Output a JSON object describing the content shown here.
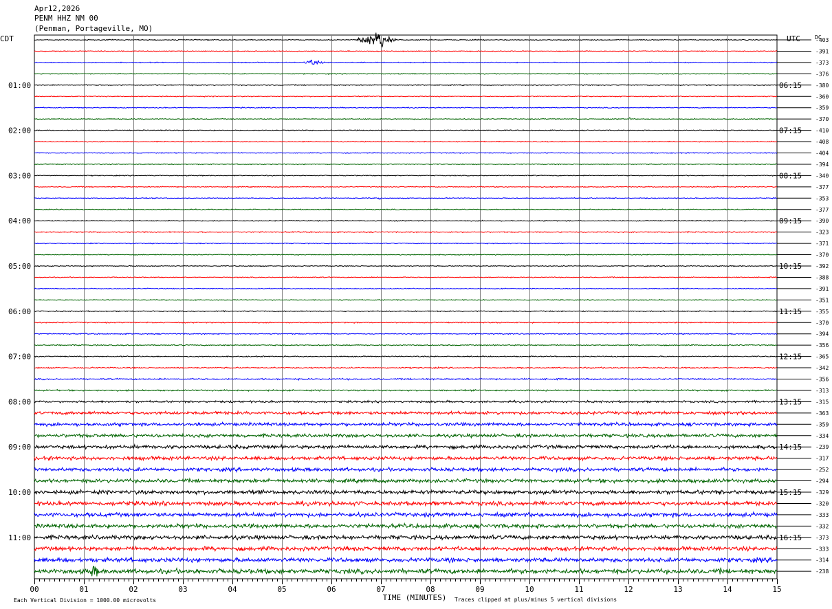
{
  "header": {
    "date": "Apr12,2026",
    "station": "PENM HHZ NM 00",
    "location": "(Penman, Portageville, MO)"
  },
  "zones": {
    "left": "CDT",
    "right": "UTC",
    "dc_header": "DC"
  },
  "chart_data": {
    "type": "line",
    "title": "",
    "xlabel": "TIME (MINUTES)",
    "ylabel": "",
    "xlim": [
      0,
      15
    ],
    "x_ticks": [
      "00",
      "01",
      "02",
      "03",
      "04",
      "05",
      "06",
      "07",
      "08",
      "09",
      "10",
      "11",
      "12",
      "13",
      "14",
      "15"
    ],
    "minutes_per_line": 15,
    "num_traces": 48,
    "colors": [
      "#000000",
      "#ff0000",
      "#0000ff",
      "#006400"
    ],
    "grid": true,
    "left_hour_labels": [
      {
        "trace": 4,
        "label": "01:00"
      },
      {
        "trace": 8,
        "label": "02:00"
      },
      {
        "trace": 12,
        "label": "03:00"
      },
      {
        "trace": 16,
        "label": "04:00"
      },
      {
        "trace": 20,
        "label": "05:00"
      },
      {
        "trace": 24,
        "label": "06:00"
      },
      {
        "trace": 28,
        "label": "07:00"
      },
      {
        "trace": 32,
        "label": "08:00"
      },
      {
        "trace": 36,
        "label": "09:00"
      },
      {
        "trace": 40,
        "label": "10:00"
      },
      {
        "trace": 44,
        "label": "11:00"
      }
    ],
    "right_hour_labels": [
      {
        "trace": 4,
        "label": "06:15"
      },
      {
        "trace": 8,
        "label": "07:15"
      },
      {
        "trace": 12,
        "label": "08:15"
      },
      {
        "trace": 16,
        "label": "09:15"
      },
      {
        "trace": 20,
        "label": "10:15"
      },
      {
        "trace": 24,
        "label": "11:15"
      },
      {
        "trace": 28,
        "label": "12:15"
      },
      {
        "trace": 32,
        "label": "13:15"
      },
      {
        "trace": 36,
        "label": "14:15"
      },
      {
        "trace": 40,
        "label": "15:15"
      },
      {
        "trace": 44,
        "label": "16:15"
      }
    ],
    "dc_values": [
      "-403",
      "-391",
      "-373",
      "-376",
      "-380",
      "-360",
      "-359",
      "-370",
      "-410",
      "-408",
      "-404",
      "-394",
      "-340",
      "-377",
      "-353",
      "-377",
      "-390",
      "-323",
      "-371",
      "-370",
      "-392",
      "-388",
      "-391",
      "-351",
      "-355",
      "-370",
      "-394",
      "-356",
      "-365",
      "-342",
      "-356",
      "-313",
      "-315",
      "-363",
      "-359",
      "-334",
      "-239",
      "-317",
      "-252",
      "-294",
      "-329",
      "-320",
      "-333",
      "-332",
      "-373",
      "-333",
      "-314",
      "-238"
    ],
    "noise_levels": [
      0.5,
      0.5,
      0.5,
      0.5,
      0.5,
      0.5,
      0.5,
      0.5,
      0.5,
      0.5,
      0.5,
      0.5,
      0.5,
      0.5,
      0.5,
      0.5,
      0.5,
      0.6,
      0.5,
      0.5,
      0.5,
      0.5,
      0.5,
      0.5,
      0.6,
      0.6,
      0.6,
      0.6,
      0.6,
      0.7,
      0.8,
      0.8,
      1.1,
      1.7,
      1.8,
      1.9,
      2.0,
      2.0,
      2.0,
      2.1,
      2.2,
      2.3,
      2.3,
      2.3,
      2.3,
      2.3,
      2.4,
      2.6
    ],
    "events": [
      {
        "trace": 0,
        "start_min": 6.3,
        "end_min": 7.4,
        "peak_min": 7.0,
        "amplitude": 11
      },
      {
        "trace": 2,
        "start_min": 5.3,
        "end_min": 6.0,
        "peak_min": 5.6,
        "amplitude": 3.5
      },
      {
        "trace": 47,
        "start_min": 0.9,
        "end_min": 1.5,
        "peak_min": 1.2,
        "amplitude": 8
      },
      {
        "trace": 47,
        "start_min": 13.75,
        "end_min": 14.0,
        "peak_min": 13.85,
        "amplitude": 4
      }
    ],
    "spikes": [
      {
        "trace": 7,
        "min": 12.02,
        "amplitude": 4
      },
      {
        "trace": 14,
        "min": 6.98,
        "amplitude": 2.5
      }
    ]
  },
  "footer": {
    "scale_note": "Each Vertical Division = 1000.00 microvolts",
    "clip_note": "Traces clipped at plus/minus 5 vertical divisions"
  }
}
